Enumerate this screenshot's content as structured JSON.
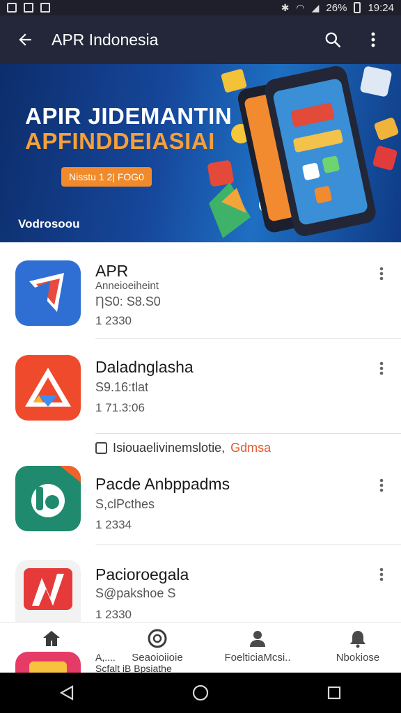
{
  "status_bar": {
    "battery": "26%",
    "time": "19:24"
  },
  "app_bar": {
    "title": "APR Indonesia",
    "icons": [
      "back-arrow-icon",
      "search-icon",
      "more-vert-icon"
    ]
  },
  "banner": {
    "line1": "APIR JIDEMANTIN",
    "line2": "APFINDDEIASIAI",
    "cta": "Nisstu 1 2| FOG0",
    "tag": "Vodrosoou"
  },
  "apps": [
    {
      "name": "APR",
      "subtitle": "Anneioeiheint",
      "price": "ȠS0: S8.S0",
      "count": "1 2330"
    },
    {
      "name": "Daladnglasha",
      "subtitle": "S9.16:tlat",
      "count": "1 71.3:06"
    },
    {
      "name": "Pacde Anbppadms",
      "subtitle": "S,clPcthes",
      "count": "1 2334"
    },
    {
      "name": "Pacioroegala",
      "subtitle": "S@pakshoe S",
      "count": "1 2330"
    }
  ],
  "checkbox_row": {
    "label": "Isiouaelivinemslotie,",
    "accent": "Gdmsa"
  },
  "peek_row": {
    "line1": "A,....",
    "line2": "Scfalt  iB  Bpsiathe"
  },
  "bottom_nav": [
    {
      "label": "",
      "icon": "home-icon"
    },
    {
      "label": "Seaoioiioie",
      "icon": "chat-bubble-icon"
    },
    {
      "label": "FoelticiaMcsi..",
      "icon": "person-icon"
    },
    {
      "label": "Nbokiose",
      "icon": "bell-icon"
    }
  ],
  "colors": {
    "status_bar": "#1e1f2b",
    "app_bar": "#24273a",
    "banner_accent": "#f6a03a",
    "accent_orange": "#e4572e"
  }
}
